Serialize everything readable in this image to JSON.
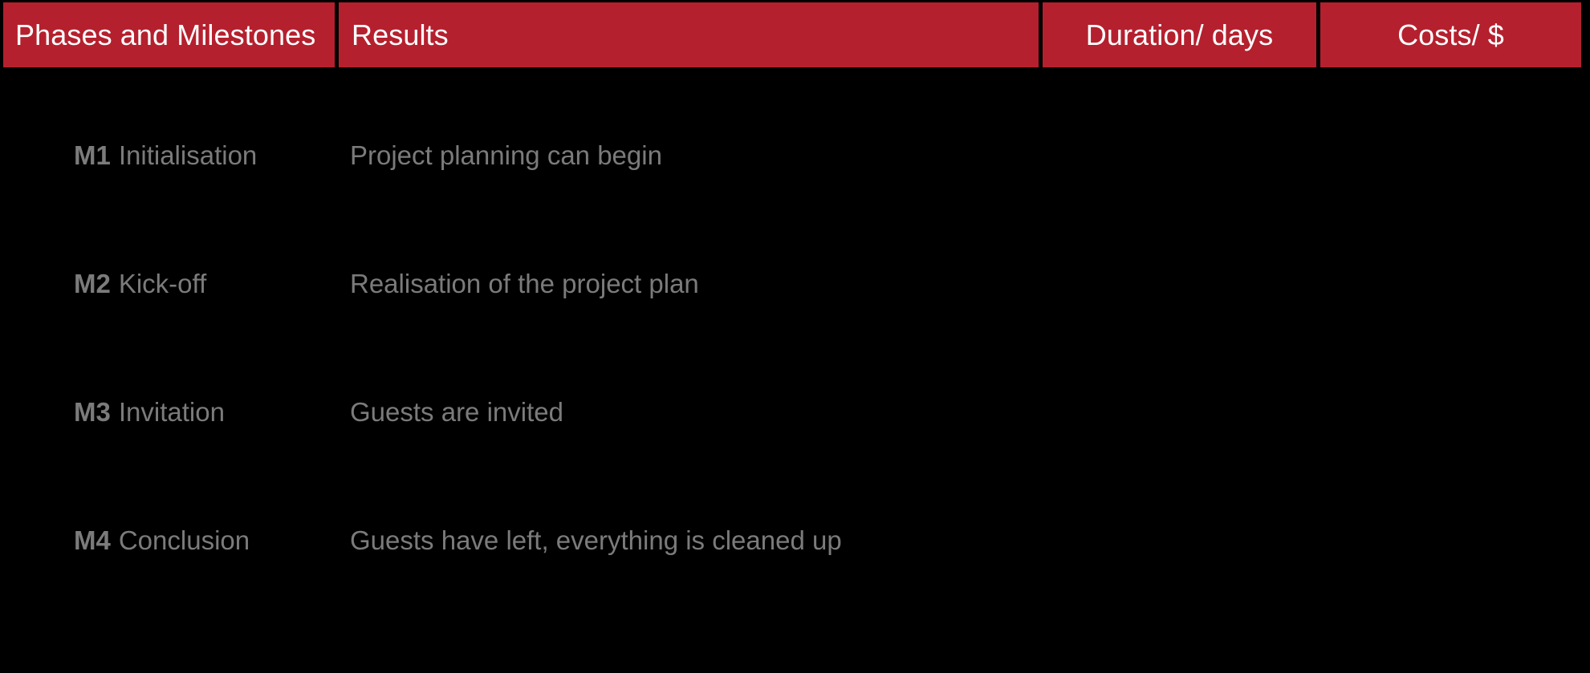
{
  "table": {
    "columns": [
      {
        "id": "phases",
        "label": "Phases and Milestones",
        "align": "left"
      },
      {
        "id": "results",
        "label": "Results",
        "align": "left"
      },
      {
        "id": "duration",
        "label": "Duration/ days",
        "align": "center"
      },
      {
        "id": "costs",
        "label": "Costs/ $",
        "align": "center"
      }
    ],
    "rows": [
      {
        "code": "M1",
        "name": "Initialisation",
        "result": "Project planning can begin",
        "duration": "",
        "costs": ""
      },
      {
        "code": "M2",
        "name": "Kick-off",
        "result": "Realisation of the project plan",
        "duration": "",
        "costs": ""
      },
      {
        "code": "M3",
        "name": "Invitation",
        "result": "Guests are invited",
        "duration": "",
        "costs": ""
      },
      {
        "code": "M4",
        "name": "Conclusion",
        "result": "Guests have left, everything is cleaned up",
        "duration": "",
        "costs": ""
      }
    ]
  },
  "colors": {
    "header_background": "#b5202e",
    "header_text": "#ffffff",
    "page_background": "#000000",
    "body_text": "#7b7b7b"
  }
}
